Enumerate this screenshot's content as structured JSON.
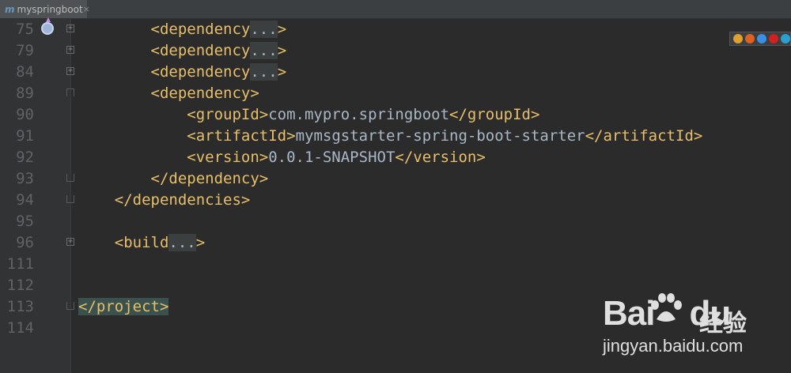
{
  "tab": {
    "title": "myspringboot",
    "icon": "maven-m-icon",
    "close": "×"
  },
  "lines": [
    {
      "num": "75",
      "fold": "plus",
      "indent": "        ",
      "parts": [
        [
          "tag",
          "<dependency"
        ],
        [
          "collapsed",
          "..."
        ],
        [
          "tag",
          ">"
        ]
      ],
      "marker": true
    },
    {
      "num": "79",
      "fold": "plus",
      "indent": "        ",
      "parts": [
        [
          "tag",
          "<dependency"
        ],
        [
          "collapsed",
          "..."
        ],
        [
          "tag",
          ">"
        ]
      ]
    },
    {
      "num": "84",
      "fold": "plus",
      "indent": "        ",
      "parts": [
        [
          "tag",
          "<dependency"
        ],
        [
          "collapsed",
          "..."
        ],
        [
          "tag",
          ">"
        ]
      ]
    },
    {
      "num": "89",
      "fold": "start",
      "indent": "        ",
      "parts": [
        [
          "tag",
          "<dependency>"
        ]
      ]
    },
    {
      "num": "90",
      "fold": "",
      "indent": "            ",
      "parts": [
        [
          "tag",
          "<groupId>"
        ],
        [
          "txt",
          "com.mypro.springboot"
        ],
        [
          "tag",
          "</groupId>"
        ]
      ]
    },
    {
      "num": "91",
      "fold": "",
      "indent": "            ",
      "parts": [
        [
          "tag",
          "<artifactId>"
        ],
        [
          "txt",
          "mymsgstarter-spring-boot-starter"
        ],
        [
          "tag",
          "</artifactId>"
        ]
      ]
    },
    {
      "num": "92",
      "fold": "",
      "indent": "            ",
      "parts": [
        [
          "tag",
          "<version>"
        ],
        [
          "txt",
          "0.0.1-SNAPSHOT"
        ],
        [
          "tag",
          "</version>"
        ]
      ]
    },
    {
      "num": "93",
      "fold": "end",
      "indent": "        ",
      "parts": [
        [
          "tag",
          "</dependency>"
        ]
      ]
    },
    {
      "num": "94",
      "fold": "end",
      "indent": "    ",
      "parts": [
        [
          "tag",
          "</dependencies>"
        ]
      ]
    },
    {
      "num": "95",
      "fold": "",
      "indent": "",
      "parts": []
    },
    {
      "num": "96",
      "fold": "plus",
      "indent": "    ",
      "parts": [
        [
          "tag",
          "<build"
        ],
        [
          "collapsed",
          "..."
        ],
        [
          "tag",
          ">"
        ]
      ]
    },
    {
      "num": "111",
      "fold": "",
      "indent": "",
      "parts": []
    },
    {
      "num": "112",
      "fold": "",
      "indent": "",
      "parts": []
    },
    {
      "num": "113",
      "fold": "end",
      "indent": "",
      "parts": [
        [
          "match",
          "</project>"
        ]
      ]
    },
    {
      "num": "114",
      "fold": "",
      "indent": "",
      "parts": []
    }
  ],
  "browser_icons": [
    {
      "name": "chrome-icon",
      "color": "#e0a030"
    },
    {
      "name": "firefox-icon",
      "color": "#e06020"
    },
    {
      "name": "safari-icon",
      "color": "#3a8ee6"
    },
    {
      "name": "opera-icon",
      "color": "#d02020"
    },
    {
      "name": "ie-icon",
      "color": "#2aa0d0"
    }
  ],
  "watermark": {
    "logo": "Bai",
    "logo_suffix": "du",
    "brand_cn": "经验",
    "url": "jingyan.baidu.com"
  }
}
